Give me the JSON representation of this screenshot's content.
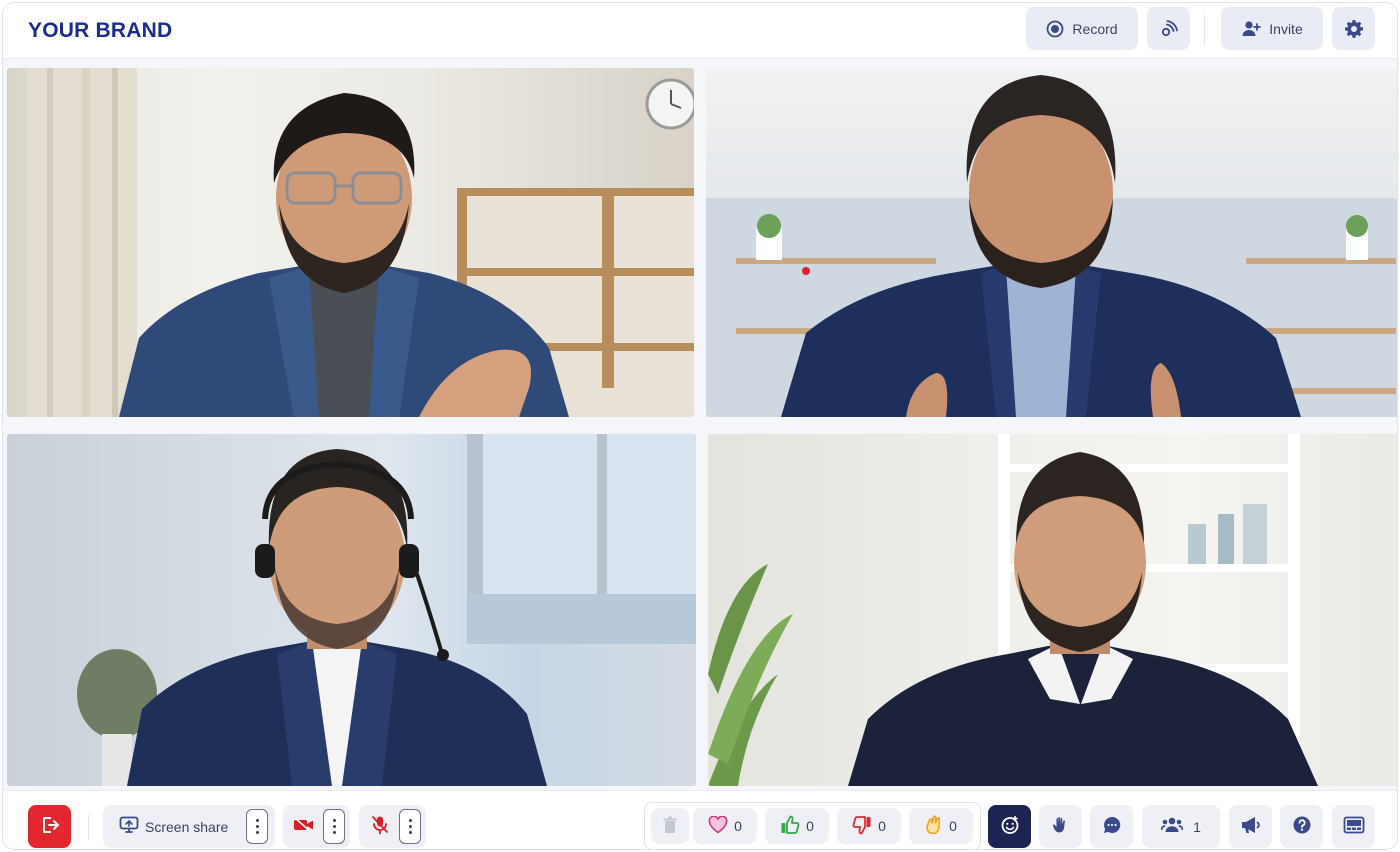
{
  "header": {
    "brand": "YOUR BRAND",
    "record_label": "Record",
    "invite_label": "Invite"
  },
  "toolbar": {
    "screen_share_label": "Screen share",
    "reactions": {
      "heart_count": "0",
      "thumbs_up_count": "0",
      "thumbs_down_count": "0",
      "clap_count": "0"
    },
    "participants_count": "1"
  },
  "icons": {
    "record": "record-icon",
    "livestream": "broadcast-icon",
    "invite": "add-user-icon",
    "settings": "gear-icon",
    "leave": "exit-icon",
    "screen_share": "monitor-share-icon",
    "camera_off": "video-off-icon",
    "mic_off": "mic-off-icon",
    "delete": "trash-icon",
    "heart": "heart-icon",
    "thumbs_up": "thumbs-up-icon",
    "thumbs_down": "thumbs-down-icon",
    "clap": "clap-icon",
    "emoji": "emoji-icon",
    "raise_hand": "hand-icon",
    "chat": "chat-icon",
    "participants": "people-icon",
    "announce": "megaphone-icon",
    "help": "help-icon",
    "layout": "layout-icon"
  },
  "colors": {
    "brand": "#1b2c8f",
    "leave": "#e2282e",
    "recording_dot": "#e01f2a",
    "active_button": "#1d2452",
    "heart": "#d2367f",
    "thumbs_up": "#2fa94a",
    "thumbs_down": "#e0262d",
    "clap": "#f0a318"
  }
}
